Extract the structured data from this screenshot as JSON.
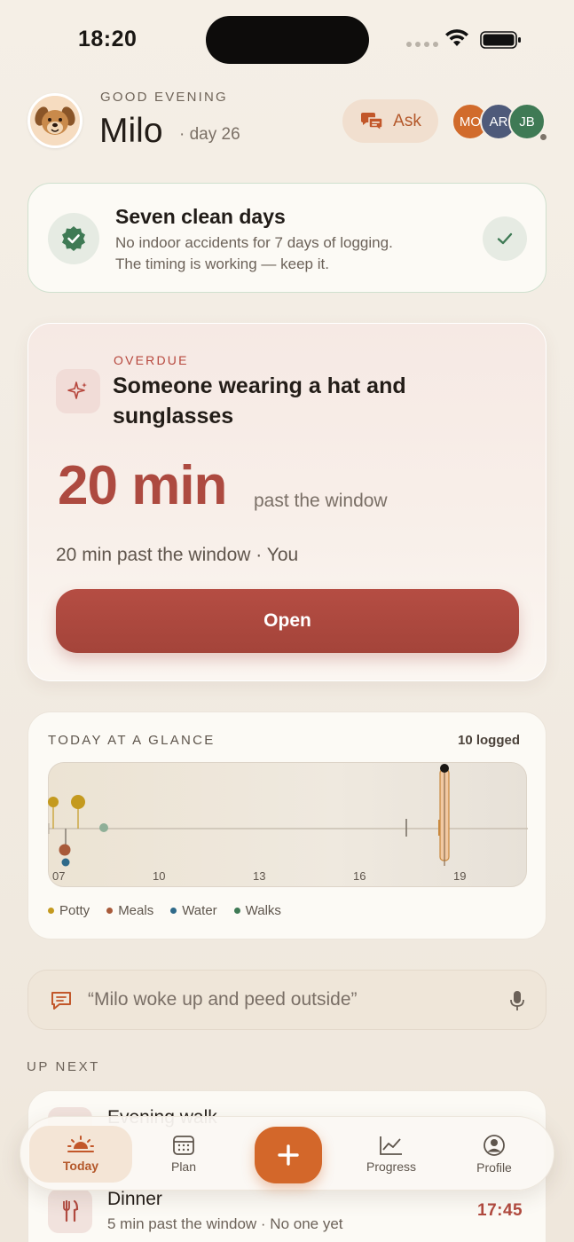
{
  "status_bar": {
    "time": "18:20"
  },
  "header": {
    "greeting": "GOOD EVENING",
    "dog_name": "Milo",
    "day_label": "· day 26",
    "ask_label": "Ask",
    "family": [
      {
        "initials": "MO",
        "color": "#d16b2c"
      },
      {
        "initials": "AR",
        "color": "#4e5a7a"
      },
      {
        "initials": "JB",
        "color": "#3f7a55"
      }
    ]
  },
  "streak": {
    "title": "Seven clean days",
    "line1": "No indoor accidents for 7 days of logging.",
    "line2": "The timing is working — keep it."
  },
  "overdue": {
    "label": "OVERDUE",
    "title": "Someone wearing a hat and sunglasses",
    "big_value": "20 min",
    "big_unit": "past the window",
    "subtitle": "20 min past the window · You",
    "button": "Open"
  },
  "glance": {
    "title": "TODAY AT A GLANCE",
    "count": "10 logged",
    "ticks": [
      "07",
      "10",
      "13",
      "16",
      "19"
    ],
    "legend": [
      {
        "label": "Potty",
        "color": "#c49a1f"
      },
      {
        "label": "Meals",
        "color": "#a85a3a"
      },
      {
        "label": "Water",
        "color": "#2f6a8a"
      },
      {
        "label": "Walks",
        "color": "#3f7a55"
      }
    ]
  },
  "quick_log": {
    "text": "“Milo woke up and peed outside”"
  },
  "up_next": {
    "label": "UP NEXT",
    "items": [
      {
        "title": "Evening walk",
        "sub": "",
        "time": ""
      },
      {
        "title": "Dinner",
        "sub": "5 min past the window · No one yet",
        "time": "17:45"
      }
    ]
  },
  "tabbar": {
    "tabs": [
      {
        "label": "Today"
      },
      {
        "label": "Plan"
      },
      {
        "label": "Progress"
      },
      {
        "label": "Profile"
      }
    ]
  }
}
